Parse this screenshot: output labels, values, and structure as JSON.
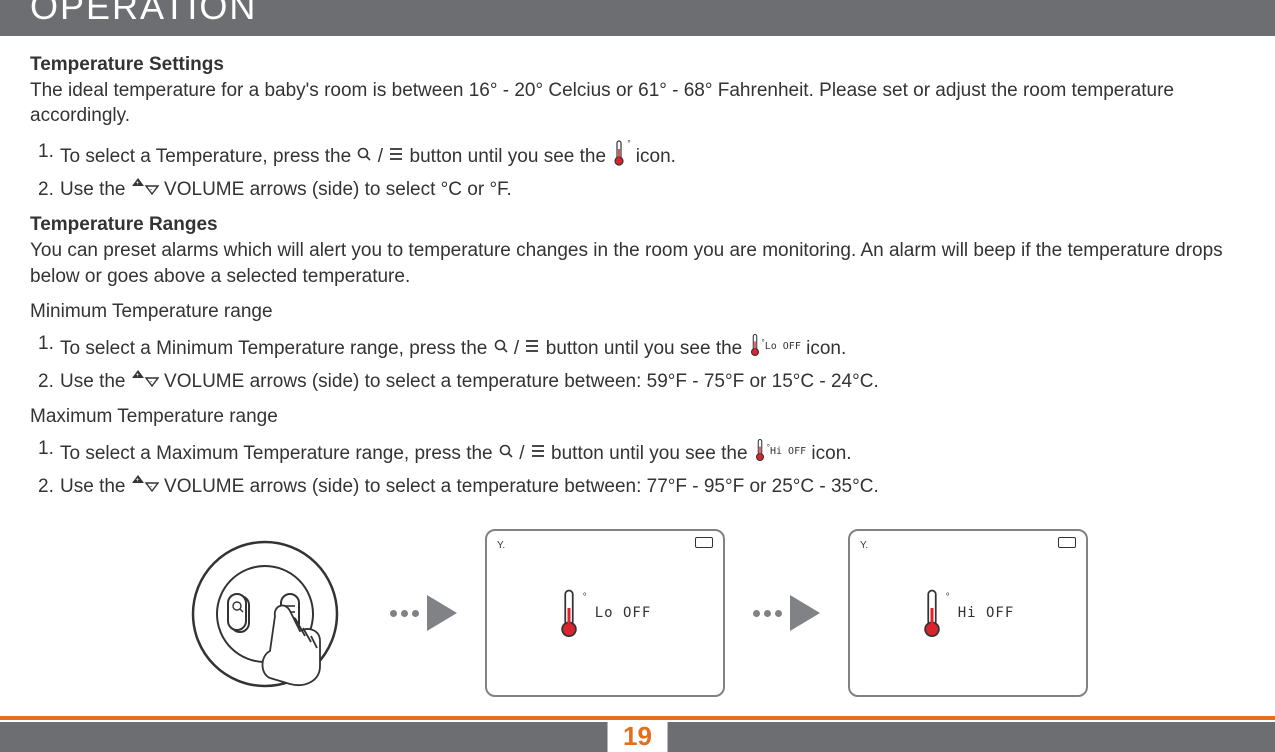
{
  "header": {
    "title": "OPERATION"
  },
  "sections": {
    "tempSettings": {
      "title": "Temperature Settings",
      "intro": "The ideal temperature for a baby's room is between 16° - 20° Celcius or 61° -  68° Fahrenheit. Please set or adjust the room temperature accordingly.",
      "steps": [
        {
          "num": "1.",
          "pre": "To select a Temperature, press the ",
          "mid": " button until you see the ",
          "post": " icon."
        },
        {
          "num": "2.",
          "pre": "Use the ",
          "post": " VOLUME arrows (side) to select °C or °F."
        }
      ]
    },
    "tempRanges": {
      "title": "Temperature Ranges",
      "intro": "You can preset alarms which will alert you to temperature changes in the room you are monitoring.  An alarm will beep if the temperature drops below or goes above a selected temperature.",
      "minTitle": "Minimum Temperature range",
      "minSteps": [
        {
          "num": "1.",
          "pre": "To select a Minimum Temperature range, press the ",
          "mid": " button until you see the ",
          "post": " icon."
        },
        {
          "num": "2.",
          "pre": "Use the ",
          "post": " VOLUME arrows (side) to select a temperature between: 59°F - 75°F or 15°C - 24°C."
        }
      ],
      "maxTitle": "Maximum Temperature range",
      "maxSteps": [
        {
          "num": "1.",
          "pre": "To select a Maximum Temperature range, press the ",
          "mid": " button until you see the ",
          "post": " icon."
        },
        {
          "num": "2.",
          "pre": "Use the ",
          "post": " VOLUME arrows (side) to select a temperature between: 77°F - 95°F or 25°C - 35°C."
        }
      ]
    }
  },
  "iconLabels": {
    "loOff": "Lo OFF",
    "hiOff": "Hi OFF"
  },
  "screens": {
    "left": "Lo OFF",
    "right": "Hi OFF"
  },
  "pageNumber": "19"
}
